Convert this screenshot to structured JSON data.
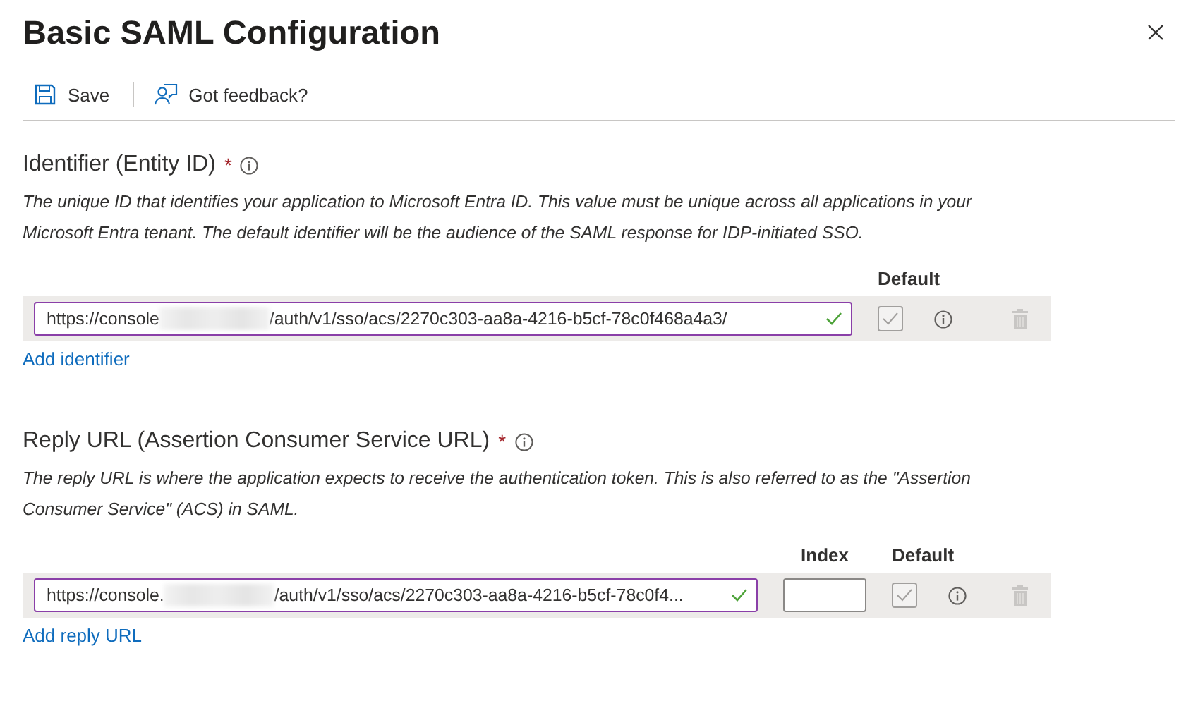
{
  "title": "Basic SAML Configuration",
  "toolbar": [
    {
      "kind": "save",
      "label": "Save"
    },
    {
      "kind": "feedback",
      "label": "Got feedback?"
    }
  ],
  "sections": [
    {
      "heading": "Identifier (Entity ID)",
      "required_mark": "*",
      "description": "The unique ID that identifies your application to Microsoft Entra ID. This value must be unique across all applications in your Microsoft Entra tenant. The default identifier will be the audience of the SAML response for IDP-initiated SSO.",
      "columns": [
        {
          "kind": "default",
          "label": "Default"
        }
      ],
      "rows": [
        {
          "value_start": "https://console",
          "value_end": "/auth/v1/sso/acs/2270c303-aa8a-4216-b5cf-78c0f468a4a3/",
          "valid": true,
          "default_checked": true,
          "default_disabled": true
        }
      ],
      "add_link": "Add identifier"
    },
    {
      "heading": "Reply URL (Assertion Consumer Service URL)",
      "required_mark": "*",
      "description": "The reply URL is where the application expects to receive the authentication token. This is also referred to as the \"Assertion Consumer Service\" (ACS) in SAML.",
      "columns": [
        {
          "kind": "index",
          "label": "Index"
        },
        {
          "kind": "default",
          "label": "Default"
        }
      ],
      "rows": [
        {
          "value_start": "https://console.",
          "value_end": "/auth/v1/sso/acs/2270c303-aa8a-4216-b5cf-78c0f4...",
          "valid": true,
          "default_checked": true,
          "default_disabled": true
        }
      ],
      "add_link": "Add reply URL"
    }
  ]
}
